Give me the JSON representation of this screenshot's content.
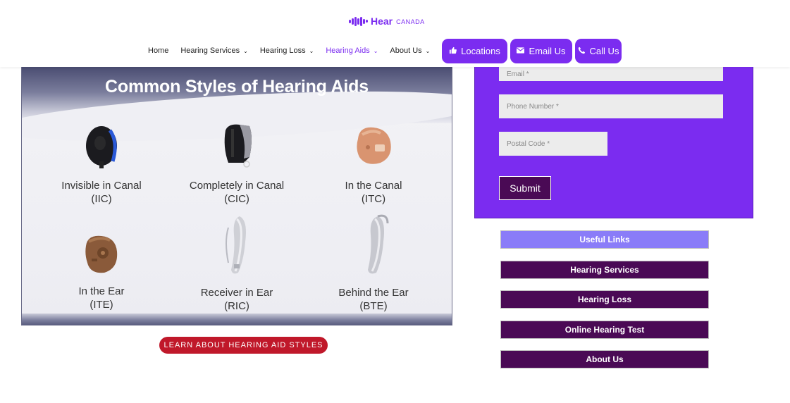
{
  "brand": {
    "name": "Hear",
    "suffix": "CANADA",
    "accent_color": "#7b2cf0"
  },
  "nav": {
    "items": [
      {
        "label": "Home",
        "dropdown": false,
        "active": false
      },
      {
        "label": "Hearing Services",
        "dropdown": true,
        "active": false
      },
      {
        "label": "Hearing Loss",
        "dropdown": true,
        "active": false
      },
      {
        "label": "Hearing Aids",
        "dropdown": true,
        "active": true
      },
      {
        "label": "About Us",
        "dropdown": true,
        "active": false
      }
    ],
    "buttons": [
      {
        "label": "Locations",
        "icon": "thumbs-up-icon"
      },
      {
        "label": "Email Us",
        "icon": "envelope-icon"
      },
      {
        "label": "Call Us",
        "icon": "phone-icon"
      }
    ]
  },
  "hero": {
    "title": "Common Styles of Hearing Aids",
    "aids": [
      {
        "name": "Invisible in Canal",
        "abbr": "(IIC)"
      },
      {
        "name": "Completely in Canal",
        "abbr": "(CIC)"
      },
      {
        "name": "In the Canal",
        "abbr": "(ITC)"
      },
      {
        "name": "In the Ear",
        "abbr": "(ITE)"
      },
      {
        "name": "Receiver in Ear",
        "abbr": "(RIC)"
      },
      {
        "name": "Behind the Ear",
        "abbr": "(BTE)"
      }
    ],
    "button_label": "LEARN ABOUT HEARING AID STYLES"
  },
  "form": {
    "email_placeholder": "Email *",
    "phone_placeholder": "Phone Number *",
    "postal_placeholder": "Postal Code *",
    "submit_label": "Submit",
    "panel_color": "#7b2cf0"
  },
  "useful_links": {
    "title": "Useful Links",
    "items": [
      "Hearing Services",
      "Hearing Loss",
      "Online Hearing Test",
      "About Us"
    ]
  }
}
